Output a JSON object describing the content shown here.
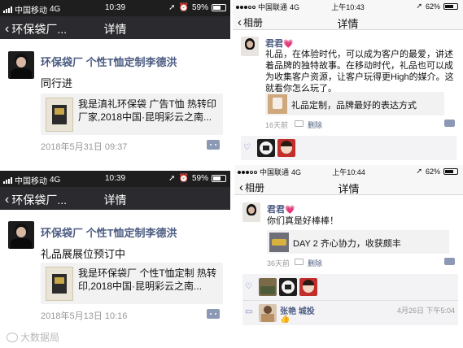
{
  "screens": [
    {
      "status": {
        "carrier": "中国移动",
        "network": "4G",
        "time": "10:39",
        "battery": "59%"
      },
      "nav": {
        "back_label": "环保袋厂...",
        "title": "详情"
      },
      "post": {
        "author": "环保袋厂  个性T恤定制李德洪",
        "text": "同行进",
        "link_text": "我是滇礼环保袋 广告T恤 热转印厂家,2018中国·昆明彩云之南...",
        "date": "2018年5月31日 09:37"
      }
    },
    {
      "status": {
        "carrier": "中国联通",
        "network": "4G",
        "time": "上午10:43",
        "battery": "62%"
      },
      "nav": {
        "back_label": "相册",
        "title": "详情"
      },
      "post": {
        "author": "君君",
        "text": "礼品，在体验时代，可以成为客户的最爱，讲述着品牌的独特故事。在移动时代，礼品也可以成为收集客户资源，让客户玩得更High的媒介。这就看你怎么玩了。",
        "link_text": "礼品定制，品牌最好的表达方式",
        "time_ago": "16天前",
        "delete_label": "删除"
      }
    },
    {
      "status": {
        "carrier": "中国移动",
        "network": "4G",
        "time": "10:39",
        "battery": "59%"
      },
      "nav": {
        "back_label": "环保袋厂...",
        "title": "详情"
      },
      "post": {
        "author": "环保袋厂  个性T恤定制李德洪",
        "text": "礼品展展位预订中",
        "link_text": "我是环保袋厂  个性T恤定制 热转印,2018中国·昆明彩云之南...",
        "date": "2018年5月13日 10:16"
      }
    },
    {
      "status": {
        "carrier": "中国联通",
        "network": "4G",
        "time": "上午10:44",
        "battery": "62%"
      },
      "nav": {
        "back_label": "相册",
        "title": "详情"
      },
      "post": {
        "author": "君君",
        "text": "你们真是好棒棒！",
        "link_text": "DAY 2 齐心协力，收获颇丰",
        "time_ago": "36天前",
        "delete_label": "删除",
        "comment": {
          "author": "张艳 城投",
          "emoji": "👍",
          "time": "4月26日 下午5:04"
        }
      }
    }
  ],
  "watermark": "大数据局",
  "colors": {
    "author_blue": "#4c5c82",
    "dark_bar": "#2b2b2f",
    "light_bar": "#f7f7f7"
  }
}
